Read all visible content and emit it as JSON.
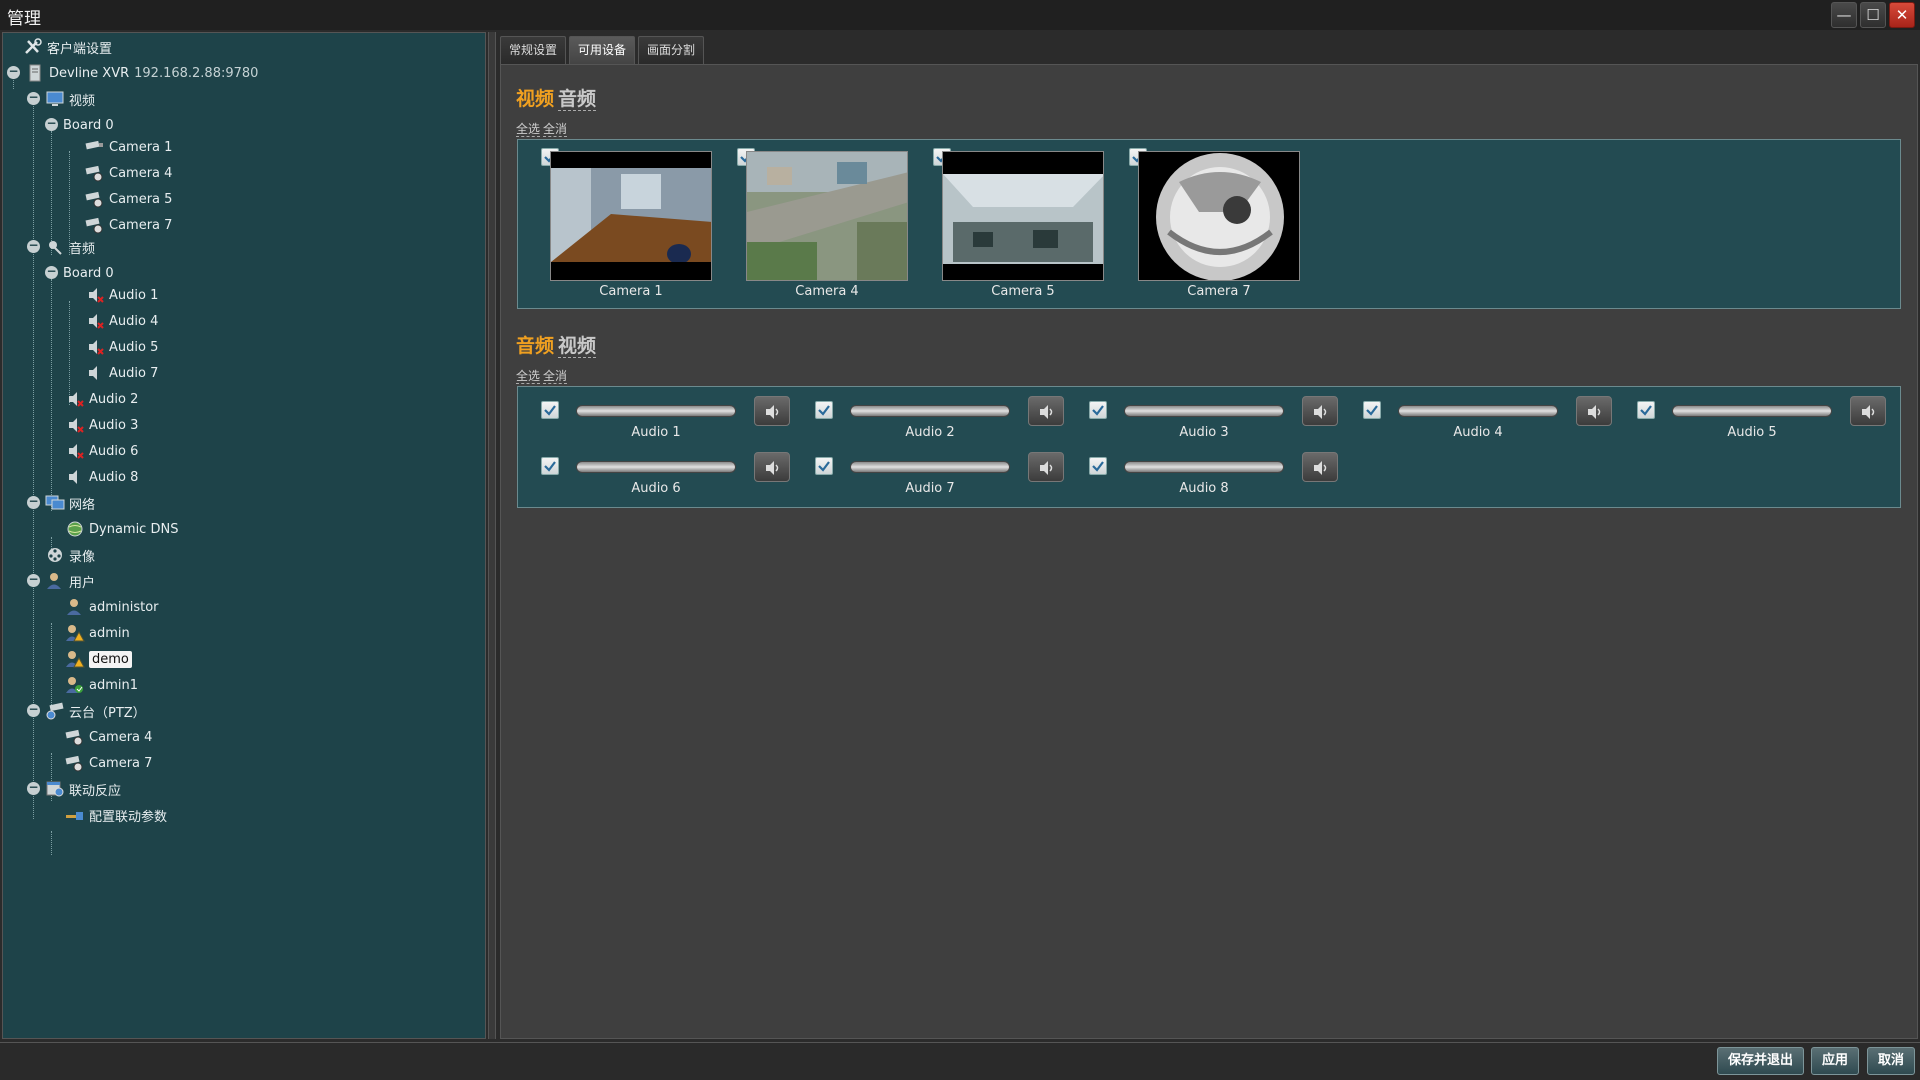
{
  "window": {
    "title": "管理",
    "min_symbol": "—",
    "max_symbol": "☐",
    "close_symbol": "✕"
  },
  "tree": {
    "client_settings": "客户端设置",
    "server_name": "Devline XVR",
    "server_address": "192.168.2.88:9780",
    "video": "视频",
    "video_board": "Board 0",
    "video_cameras": [
      "Camera 1",
      "Camera 4",
      "Camera 5",
      "Camera 7"
    ],
    "audio": "音频",
    "audio_board": "Board 0",
    "board_audios": [
      "Audio 1",
      "Audio 4",
      "Audio 5",
      "Audio 7"
    ],
    "extra_audios": [
      "Audio 2",
      "Audio 3",
      "Audio 6",
      "Audio 8"
    ],
    "network": "网络",
    "dynamic_dns": "Dynamic DNS",
    "recording": "录像",
    "users": "用户",
    "user_list": [
      "administor",
      "admin",
      "demo",
      "admin1"
    ],
    "ptz": "云台（PTZ）",
    "ptz_cameras": [
      "Camera 4",
      "Camera 7"
    ],
    "linkage": "联动反应",
    "linkage_config": "配置联动参数"
  },
  "tabs": [
    "常规设置",
    "可用设备",
    "画面分割"
  ],
  "video_section": {
    "title_active": "视频",
    "title_link": "音频",
    "select_all": "全选",
    "deselect_all": "全消",
    "cameras": [
      "Camera 1",
      "Camera 4",
      "Camera 5",
      "Camera 7"
    ]
  },
  "audio_section": {
    "title_active": "音频",
    "title_link": "视频",
    "select_all": "全选",
    "deselect_all": "全消",
    "audios": [
      "Audio 1",
      "Audio 2",
      "Audio 3",
      "Audio 4",
      "Audio 5",
      "Audio 6",
      "Audio 7",
      "Audio 8"
    ]
  },
  "buttons": {
    "save_exit": "保存并退出",
    "apply": "应用",
    "cancel": "取消"
  },
  "colors": {
    "tree_bg": "#1e4349",
    "accent_orange": "#f0a020",
    "box_bg": "#234b52"
  }
}
